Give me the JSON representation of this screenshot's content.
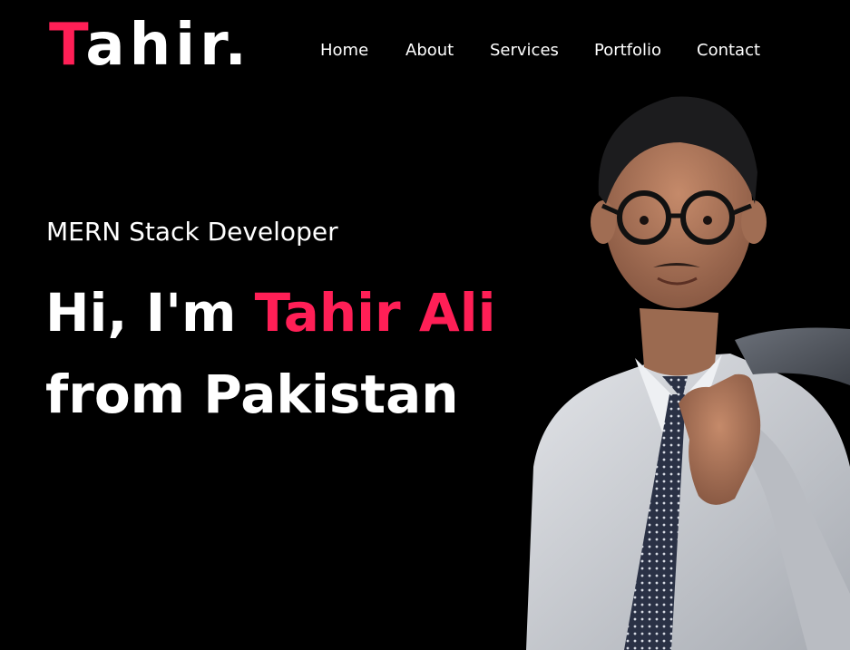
{
  "brand": {
    "logo_initial": "T",
    "logo_rest": "ahir.",
    "accent_color": "#ff1f56",
    "text_color": "#ffffff",
    "background_color": "#000000"
  },
  "nav": {
    "items": [
      {
        "label": "Home"
      },
      {
        "label": "About"
      },
      {
        "label": "Services"
      },
      {
        "label": "Portfolio"
      },
      {
        "label": "Contact"
      }
    ]
  },
  "hero": {
    "role": "MERN Stack Developer",
    "greeting_prefix": "Hi, I'm ",
    "name": "Tahir Ali",
    "line2": "from Pakistan"
  },
  "portrait": {
    "icon": "person-photo"
  }
}
